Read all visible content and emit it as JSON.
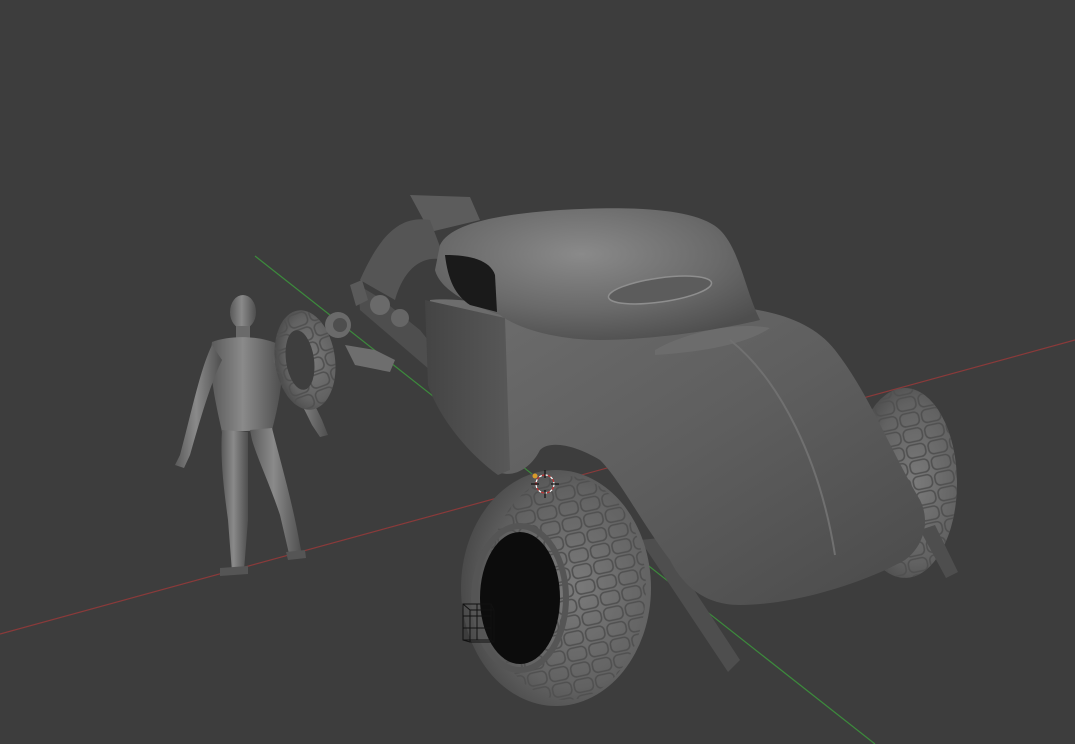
{
  "viewport": {
    "background": "#3d3d3d",
    "shading": "solid",
    "objects": [
      "human-figure",
      "spare-tire",
      "hot-rod-car",
      "front-tire",
      "rear-tire",
      "light-probe-cage"
    ],
    "axis_colors": {
      "x_axis": "#8a3a3a",
      "y_axis": "#3c8a3c"
    },
    "cursor": {
      "icon": "3d-cursor-icon",
      "ring_color": "#c83030"
    }
  }
}
